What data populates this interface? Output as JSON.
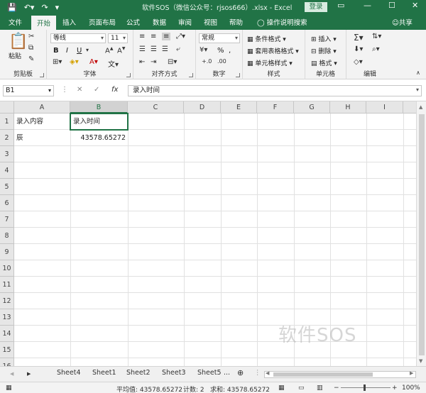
{
  "window": {
    "title": "软件SOS（微信公众号：rjsos666）.xlsx  -  Excel",
    "login_button": "登录",
    "minimize": "—",
    "restore": "☐",
    "close": "✕"
  },
  "quick_access": {
    "save_icon": "save-icon",
    "undo_icon": "undo-icon",
    "redo_icon": "redo-icon",
    "customize_icon": "customize-icon"
  },
  "tabs": [
    "文件",
    "开始",
    "插入",
    "页面布局",
    "公式",
    "数据",
    "审阅",
    "视图",
    "帮助"
  ],
  "active_tab": "开始",
  "tell_me": "操作说明搜索",
  "share": "共享",
  "ribbon": {
    "clipboard": {
      "label": "剪贴板",
      "paste": "粘贴"
    },
    "font": {
      "label": "字体",
      "font_name": "等线",
      "font_size": "11",
      "bold": "B",
      "italic": "I",
      "underline": "U"
    },
    "alignment": {
      "label": "对齐方式"
    },
    "number": {
      "label": "数字",
      "format": "常规",
      "percent": "%",
      "comma": ","
    },
    "styles": {
      "label": "样式",
      "conditional": "条件格式",
      "table": "套用表格格式",
      "cell_styles": "单元格样式"
    },
    "cells": {
      "label": "单元格",
      "insert": "插入",
      "delete": "删除",
      "format": "格式"
    },
    "editing": {
      "label": "编辑"
    }
  },
  "formula_bar": {
    "name_box": "B1",
    "cancel": "✕",
    "enter": "✓",
    "fx": "fx",
    "content": "录入时间"
  },
  "columns": [
    "A",
    "B",
    "C",
    "D",
    "E",
    "F",
    "G",
    "H",
    "I"
  ],
  "rows": [
    "1",
    "2",
    "3",
    "4",
    "5",
    "6",
    "7",
    "8",
    "9",
    "10",
    "11",
    "12",
    "13",
    "14",
    "15",
    "16"
  ],
  "cells": {
    "A1": "录入内容",
    "B1": "录入时间",
    "A2": "辰",
    "B2": "43578.65272"
  },
  "selected_cell": "B1",
  "watermark": "软件SOS",
  "sheets": [
    "Sheet4",
    "Sheet1",
    "Sheet2",
    "Sheet3",
    "Sheet5"
  ],
  "sheets_more": "...",
  "status": {
    "average": "平均值: 43578.65272",
    "count": "计数: 2",
    "sum": "求和: 43578.65272",
    "zoom": "100%"
  }
}
